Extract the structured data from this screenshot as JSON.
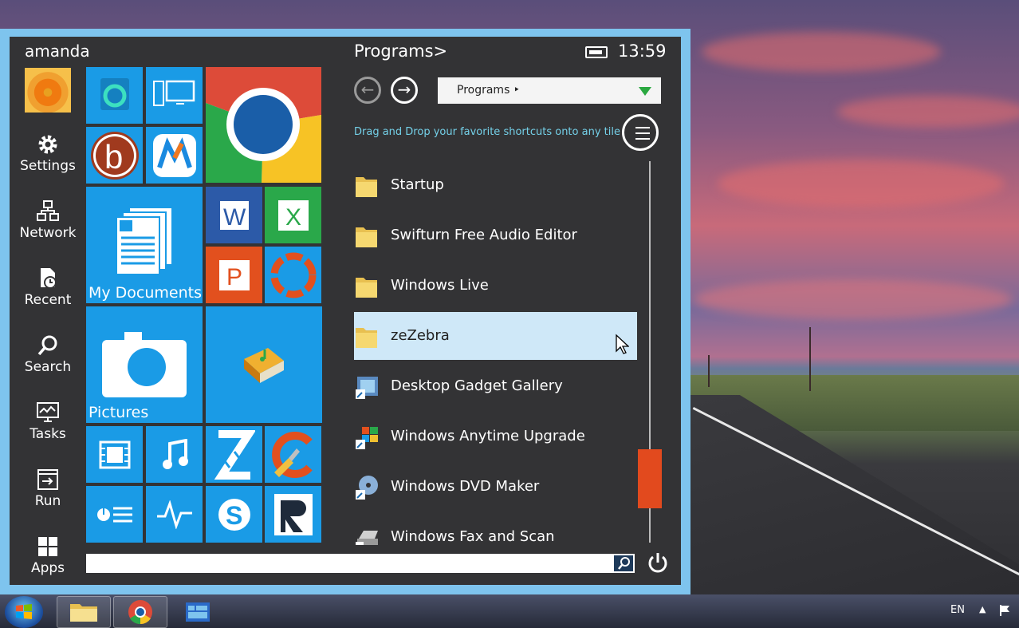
{
  "user": {
    "name": "amanda"
  },
  "sidebar": {
    "items": [
      {
        "label": "Settings",
        "icon": "gear-icon"
      },
      {
        "label": "Network",
        "icon": "network-icon"
      },
      {
        "label": "Recent",
        "icon": "recent-icon"
      },
      {
        "label": "Search",
        "icon": "search-icon"
      },
      {
        "label": "Tasks",
        "icon": "tasks-icon"
      },
      {
        "label": "Run",
        "icon": "run-icon"
      },
      {
        "label": "Apps",
        "icon": "apps-icon"
      }
    ]
  },
  "tiles": {
    "my_documents": "My Documents",
    "pictures": "Pictures"
  },
  "programs": {
    "header": "Programs>",
    "clock": "13:59",
    "dropdown_value": "Programs ‣",
    "hint": "Drag and Drop your favorite shortcuts onto any tile",
    "items": [
      {
        "label": "Startup",
        "icon": "folder-icon"
      },
      {
        "label": "Swifturn Free Audio Editor",
        "icon": "folder-icon"
      },
      {
        "label": "Windows Live",
        "icon": "folder-icon"
      },
      {
        "label": "zeZebra",
        "icon": "folder-icon",
        "selected": true
      },
      {
        "label": "Desktop Gadget Gallery",
        "icon": "gadget-icon"
      },
      {
        "label": "Windows Anytime Upgrade",
        "icon": "windows-flag-icon"
      },
      {
        "label": "Windows DVD Maker",
        "icon": "dvd-icon"
      },
      {
        "label": "Windows Fax and Scan",
        "icon": "fax-icon"
      }
    ]
  },
  "taskbar": {
    "language": "EN"
  },
  "colors": {
    "tile_blue": "#1a9be6",
    "scroll_thumb": "#e24a1e",
    "hint_text": "#74d0e8",
    "selected_row": "#cfe8f8"
  }
}
